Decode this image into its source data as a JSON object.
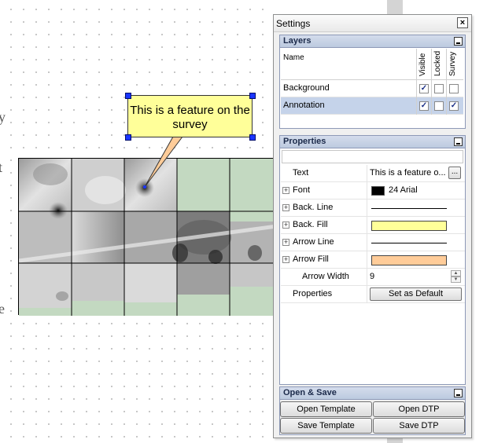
{
  "canvas": {
    "callout_text": "This is a feature on the survey",
    "margin_glyphs": [
      "y",
      "t",
      "e"
    ],
    "colors": {
      "callout_fill": "#ffff99",
      "empty_tile": "#c3d9c1",
      "handle": "#1a35ff"
    }
  },
  "settings": {
    "title": "Settings",
    "close_icon": "×",
    "layers": {
      "title": "Layers",
      "columns": {
        "name": "Name",
        "visible": "Visible",
        "locked": "Locked",
        "survey": "Survey"
      },
      "rows": [
        {
          "name": "Background",
          "visible": true,
          "locked": false,
          "survey": false,
          "selected": false
        },
        {
          "name": "Annotation",
          "visible": true,
          "locked": false,
          "survey": true,
          "selected": true
        }
      ]
    },
    "properties": {
      "title": "Properties",
      "text_label": "Text",
      "text_value": "This is a feature o...",
      "ellipsis_label": "...",
      "font_label": "Font",
      "font_value": "24 Arial",
      "back_line_label": "Back. Line",
      "back_fill_label": "Back. Fill",
      "back_fill_color": "#ffff99",
      "arrow_line_label": "Arrow Line",
      "arrow_fill_label": "Arrow Fill",
      "arrow_fill_color": "#ffcc99",
      "arrow_width_label": "Arrow Width",
      "arrow_width_value": "9",
      "properties_label": "Properties",
      "set_default_label": "Set as Default",
      "expander_glyph": "+"
    },
    "open_save": {
      "title": "Open & Save",
      "open_template": "Open Template",
      "open_dtp": "Open DTP",
      "save_template": "Save Template",
      "save_dtp": "Save DTP"
    }
  }
}
